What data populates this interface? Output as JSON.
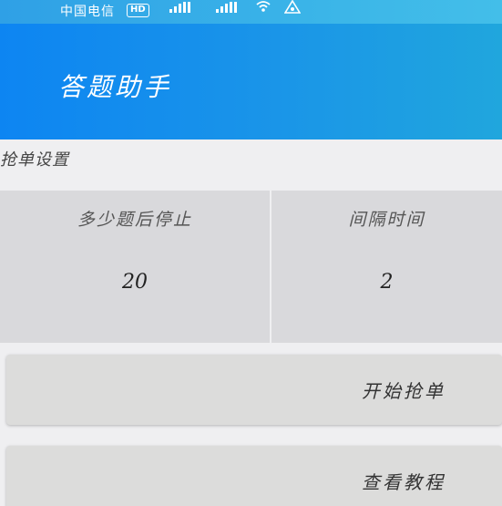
{
  "status_bar": {
    "carrier": "中国电信",
    "network_badge": "HD",
    "icons": [
      "signal-icon",
      "signal-icon",
      "wifi-icon",
      "alert-icon"
    ]
  },
  "header": {
    "title": "答题助手",
    "color_start": "#0d85f2",
    "color_end": "#20a6dd"
  },
  "section": {
    "label": "抢单设置"
  },
  "settings": {
    "stop_after": {
      "label": "多少题后停止",
      "value": "20"
    },
    "interval": {
      "label": "间隔时间",
      "value": "2"
    }
  },
  "buttons": {
    "start_label": "开始抢单",
    "tutorial_label": "查看教程"
  }
}
